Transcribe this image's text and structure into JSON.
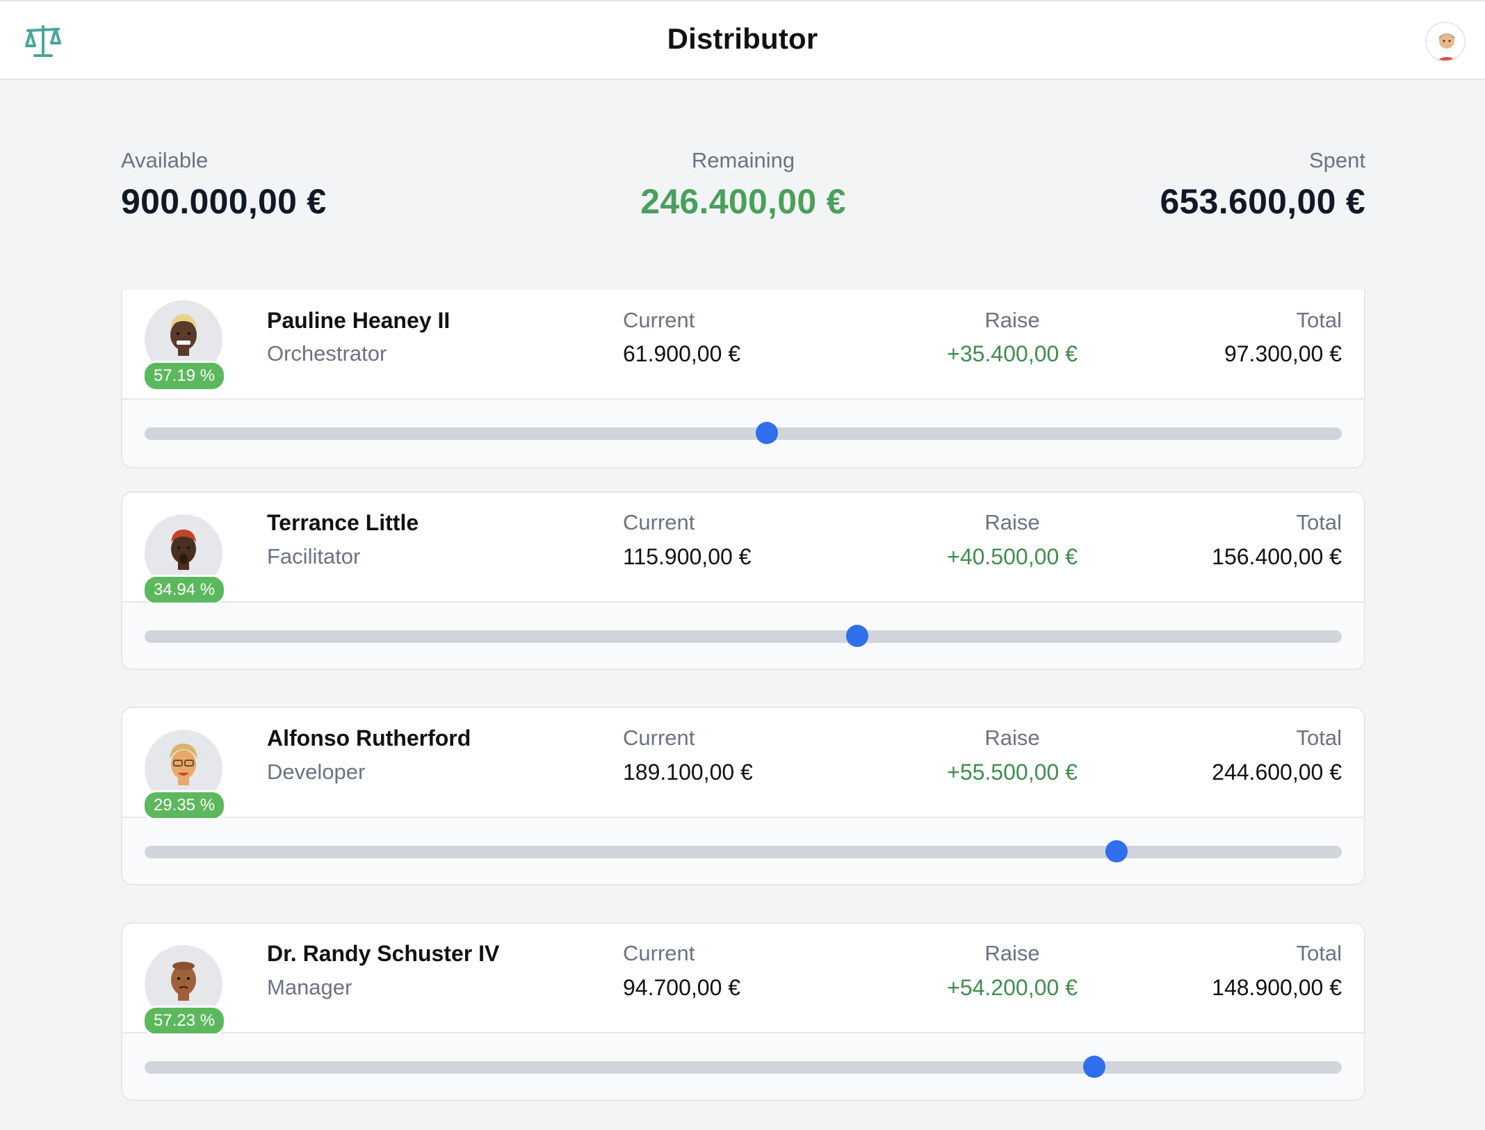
{
  "header": {
    "title": "Distributor",
    "logo_icon": "scale-icon",
    "accent": "#4aa59a"
  },
  "summary": {
    "available_label": "Available",
    "available_value": "900.000,00 €",
    "remaining_label": "Remaining",
    "remaining_value": "246.400,00 €",
    "spent_label": "Spent",
    "spent_value": "653.600,00 €"
  },
  "labels": {
    "current": "Current",
    "raise": "Raise",
    "total": "Total"
  },
  "employees": [
    {
      "name": "Pauline Heaney II",
      "role": "Orchestrator",
      "percent": "57.19 %",
      "current": "61.900,00 €",
      "raise": "+35.400,00 €",
      "total": "97.300,00 €",
      "slider_fraction": 0.52
    },
    {
      "name": "Terrance Little",
      "role": "Facilitator",
      "percent": "34.94 %",
      "current": "115.900,00 €",
      "raise": "+40.500,00 €",
      "total": "156.400,00 €",
      "slider_fraction": 0.595
    },
    {
      "name": "Alfonso Rutherford",
      "role": "Developer",
      "percent": "29.35 %",
      "current": "189.100,00 €",
      "raise": "+55.500,00 €",
      "total": "244.600,00 €",
      "slider_fraction": 0.812
    },
    {
      "name": "Dr. Randy Schuster IV",
      "role": "Manager",
      "percent": "57.23 %",
      "current": "94.700,00 €",
      "raise": "+54.200,00 €",
      "total": "148.900,00 €",
      "slider_fraction": 0.793
    }
  ],
  "colors": {
    "positive": "#3f8d4e",
    "badge": "#5cb85c",
    "slider_thumb": "#2f6fec",
    "slider_track": "#d1d5db"
  }
}
